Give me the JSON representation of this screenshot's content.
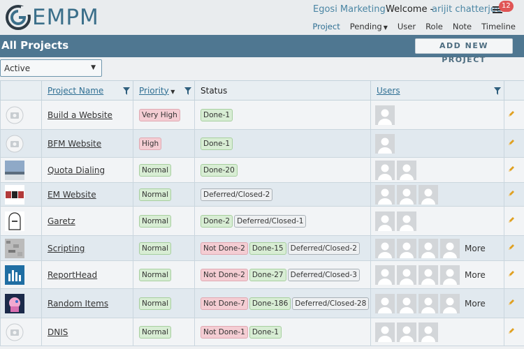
{
  "header": {
    "logo_text": "EMPM",
    "company": "Egosi Marketing",
    "welcome": "Welcome  -",
    "username": "arijit chatterjee",
    "notification_count": "12",
    "nav": [
      {
        "label": "Project",
        "active": true
      },
      {
        "label": "Pending",
        "dropdown": true
      },
      {
        "label": "User"
      },
      {
        "label": "Role"
      },
      {
        "label": "Note"
      },
      {
        "label": "Timeline"
      }
    ]
  },
  "titlebar": {
    "title": "All Projects",
    "add_button": "ADD NEW PROJECT"
  },
  "filter": {
    "selected": "Active"
  },
  "table": {
    "columns": {
      "name": "Project Name",
      "priority": "Priority",
      "status": "Status",
      "users": "Users"
    },
    "rows": [
      {
        "name": "Build a Website",
        "thumb": "camera-placeholder-icon",
        "priority": "Very High",
        "priority_type": "high",
        "status": [
          {
            "text": "Done-1",
            "type": "done"
          }
        ],
        "users": 1,
        "more": ""
      },
      {
        "name": "BFM Website",
        "thumb": "camera-placeholder-icon",
        "priority": "High",
        "priority_type": "high",
        "status": [
          {
            "text": "Done-1",
            "type": "done"
          }
        ],
        "users": 1,
        "more": ""
      },
      {
        "name": "Quota Dialing",
        "thumb": "landscape-thumbnail",
        "priority": "Normal",
        "priority_type": "normal",
        "status": [
          {
            "text": "Done-20",
            "type": "done"
          }
        ],
        "users": 2,
        "more": ""
      },
      {
        "name": "EM Website",
        "thumb": "em-logo-thumbnail",
        "priority": "Normal",
        "priority_type": "normal",
        "status": [
          {
            "text": "Deferred/Closed-2",
            "type": "deferred"
          }
        ],
        "users": 3,
        "more": ""
      },
      {
        "name": "Garetz",
        "thumb": "tombstone-thumbnail",
        "priority": "Normal",
        "priority_type": "normal",
        "status": [
          {
            "text": "Done-2",
            "type": "done"
          },
          {
            "text": "Deferred/Closed-1",
            "type": "deferred"
          }
        ],
        "users": 2,
        "more": ""
      },
      {
        "name": "Scripting",
        "thumb": "noise-thumbnail",
        "priority": "Normal",
        "priority_type": "normal",
        "status": [
          {
            "text": "Not Done-2",
            "type": "notdone"
          },
          {
            "text": "Done-15",
            "type": "done"
          },
          {
            "text": "Deferred/Closed-2",
            "type": "deferred"
          }
        ],
        "users": 4,
        "more": "More"
      },
      {
        "name": "ReportHead",
        "thumb": "bar-chart-thumbnail",
        "priority": "Normal",
        "priority_type": "normal",
        "status": [
          {
            "text": "Not Done-2",
            "type": "notdone"
          },
          {
            "text": "Done-27",
            "type": "done"
          },
          {
            "text": "Deferred/Closed-3",
            "type": "deferred"
          }
        ],
        "users": 4,
        "more": "More"
      },
      {
        "name": "Random Items",
        "thumb": "cartoon-pony-thumbnail",
        "priority": "Normal",
        "priority_type": "normal",
        "status": [
          {
            "text": "Not Done-7",
            "type": "notdone"
          },
          {
            "text": "Done-186",
            "type": "done"
          },
          {
            "text": "Deferred/Closed-28",
            "type": "deferred"
          }
        ],
        "users": 4,
        "more": "More"
      },
      {
        "name": "DNIS",
        "thumb": "camera-placeholder-icon",
        "priority": "Normal",
        "priority_type": "normal",
        "status": [
          {
            "text": "Not Done-1",
            "type": "notdone"
          },
          {
            "text": "Done-1",
            "type": "done"
          }
        ],
        "users": 3,
        "more": ""
      }
    ]
  }
}
